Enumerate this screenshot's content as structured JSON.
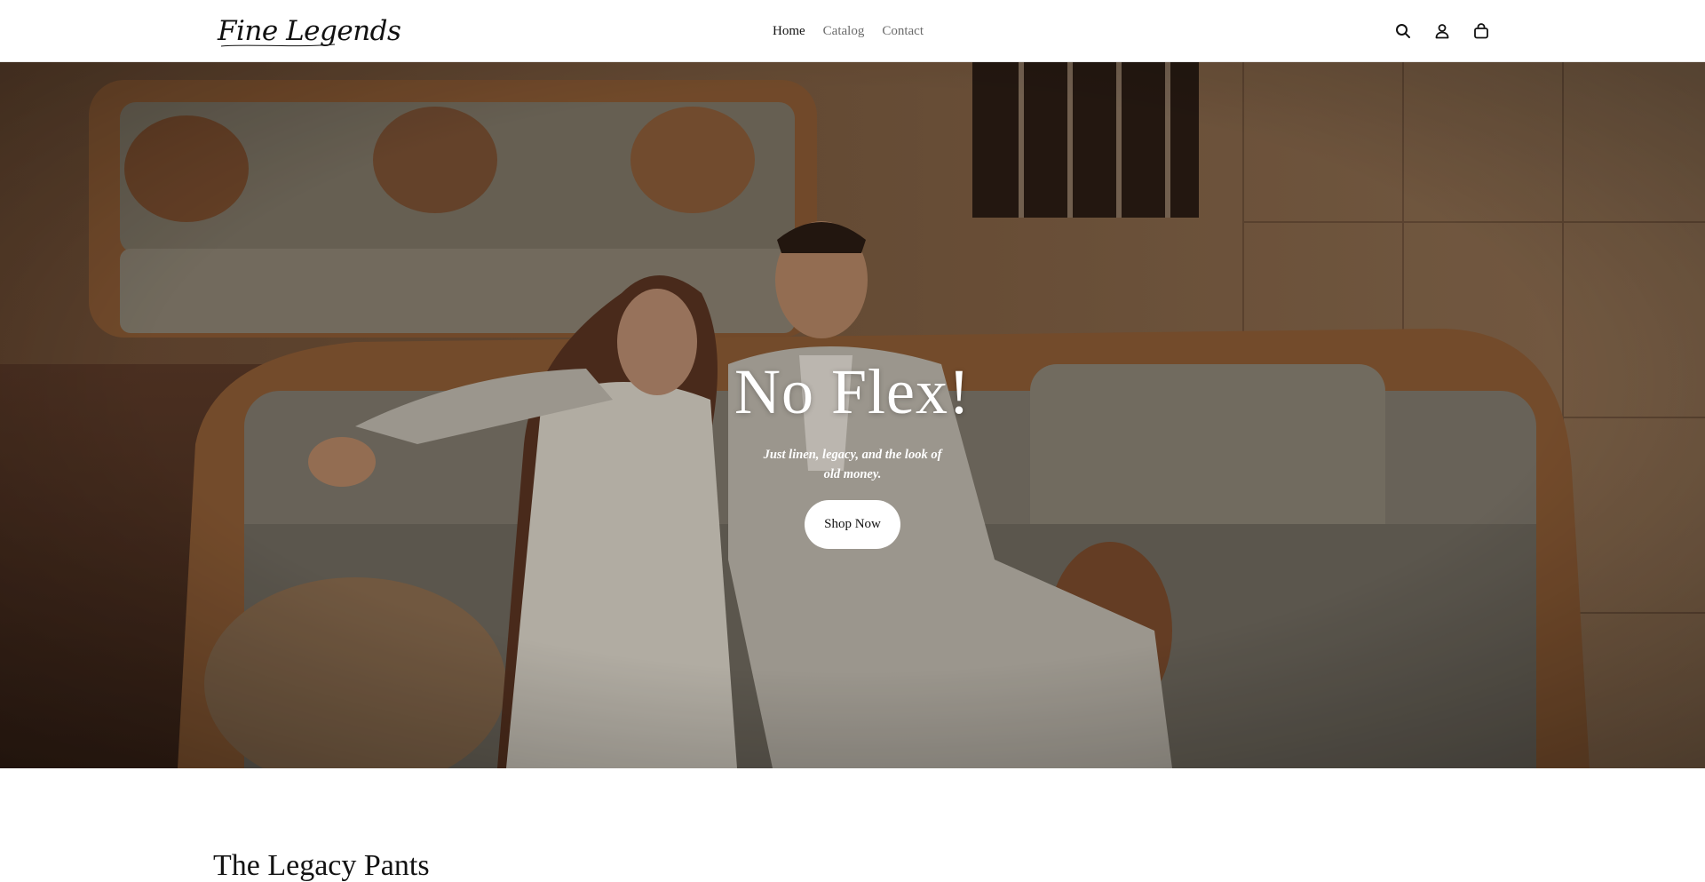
{
  "brand": {
    "logo_text": "Fine Legends"
  },
  "nav": {
    "items": [
      {
        "label": "Home",
        "active": true
      },
      {
        "label": "Catalog",
        "active": false
      },
      {
        "label": "Contact",
        "active": false
      }
    ]
  },
  "header_icons": [
    "search-icon",
    "account-icon",
    "cart-icon"
  ],
  "hero": {
    "title": "No Flex!",
    "subtitle": "Just linen, legacy, and the look of old money.",
    "cta_label": "Shop Now"
  },
  "collection": {
    "title": "The Legacy Pants"
  },
  "colors": {
    "text": "#121212",
    "nav_inactive": "#6b6b6b",
    "header_bg": "#ffffff",
    "hero_tone": "#5a4431",
    "button_bg": "#ffffff"
  }
}
